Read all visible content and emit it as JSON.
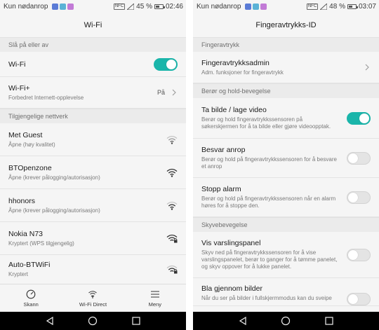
{
  "left": {
    "status": {
      "carrier": "Kun nødanrop",
      "battery_text": "45 %",
      "battery_level": 0.45,
      "time": "02:46",
      "nfc": "NFC"
    },
    "title": "Wi-Fi",
    "sections": {
      "toggle_header": "Slå på eller av",
      "networks_header": "Tilgjengelige nettverk"
    },
    "wifi_row": {
      "label": "Wi-Fi",
      "enabled": true
    },
    "wifiplus_row": {
      "label": "Wi-Fi+",
      "sub": "Forbedret Internett-opplevelse",
      "value": "På"
    },
    "networks": [
      {
        "name": "Met Guest",
        "sub": "Åpne (høy kvalitet)",
        "icon": "wifi-open-icon"
      },
      {
        "name": "BTOpenzone",
        "sub": "Åpne (krever pålogging/autorisasjon)",
        "icon": "wifi-open-icon"
      },
      {
        "name": "hhonors",
        "sub": "Åpne (krever pålogging/autorisasjon)",
        "icon": "wifi-open-icon"
      },
      {
        "name": "Nokia N73",
        "sub": "Kryptert (WPS tilgjengelig)",
        "icon": "wifi-locked-icon"
      },
      {
        "name": "Auto-BTWiFi",
        "sub": "Kryptert",
        "icon": "wifi-locked-icon"
      }
    ],
    "bottom": {
      "scan": "Skann",
      "direct": "Wi-Fi Direct",
      "menu": "Meny"
    }
  },
  "right": {
    "status": {
      "carrier": "Kun nødanrop",
      "battery_text": "48 %",
      "battery_level": 0.48,
      "time": "03:07",
      "nfc": "NFC"
    },
    "title": "Fingeravtrykks-ID",
    "sections": {
      "fingerprint": "Fingeravtrykk",
      "touch_hold": "Berør og hold-bevegelse",
      "swipe": "Skyvebevegelse"
    },
    "admin": {
      "label": "Fingeravtrykksadmin",
      "sub": "Adm. funksjoner for fingeravtrykk"
    },
    "photo": {
      "label": "Ta bilde / lage video",
      "sub": "Berør og hold fingeravtrykkssensoren på søkerskjermen for å ta bilde eller gjøre videoopptak.",
      "enabled": true
    },
    "answer": {
      "label": "Besvar anrop",
      "sub": "Berør og hold på fingeravtrykkssensoren for å besvare et anrop",
      "enabled": false
    },
    "alarm": {
      "label": "Stopp alarm",
      "sub": "Berør og hold på fingeravtrykkssensoren når en alarm høres for å stoppe den.",
      "enabled": false
    },
    "notif": {
      "label": "Vis varslingspanel",
      "sub": "Skyv ned på fingeravtrykkssensoren for å vise varslingspanelet, berør to ganger for å tømme panelet, og skyv oppover for å lukke panelet.",
      "enabled": false
    },
    "browse": {
      "label": "Bla gjennom bilder",
      "sub": "Når du ser på bilder i fullskjermmodus kan du sveipe",
      "enabled": false
    }
  },
  "colors": {
    "accent": "#1ab5aa",
    "background": "#f5f5f5",
    "section": "#ebebeb"
  }
}
